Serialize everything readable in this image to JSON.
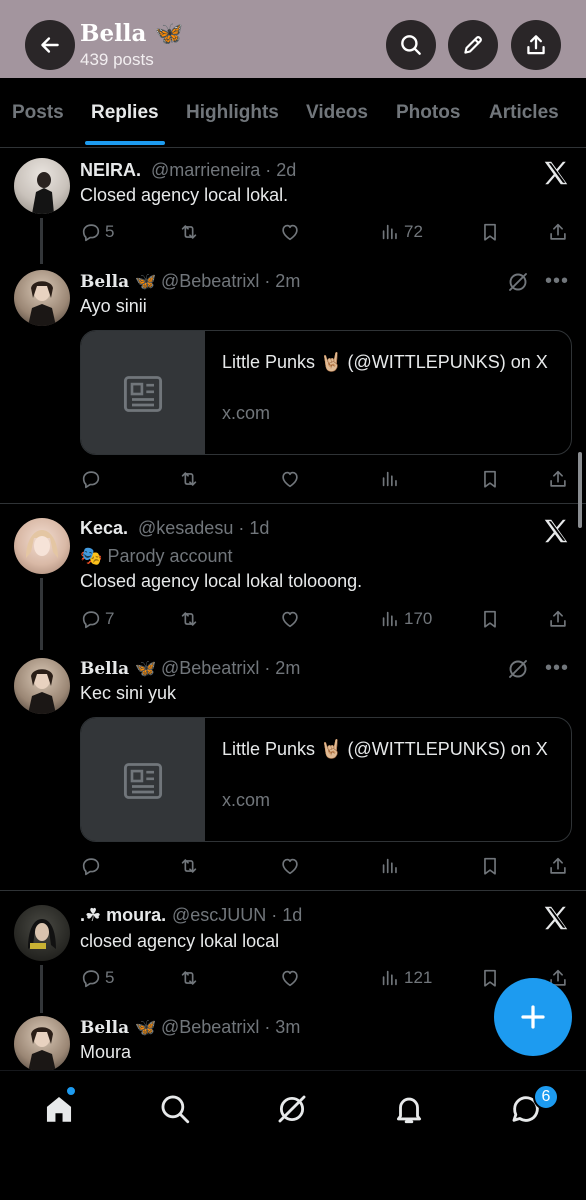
{
  "header": {
    "title": "Bella 🦋",
    "subtitle": "439 posts",
    "bg_color": "#a3959e"
  },
  "tabs": [
    {
      "label": "Posts"
    },
    {
      "label": "Replies"
    },
    {
      "label": "Highlights"
    },
    {
      "label": "Videos"
    },
    {
      "label": "Photos"
    },
    {
      "label": "Articles"
    }
  ],
  "active_tab": "Replies",
  "posts": [
    {
      "name": "NEIRA.",
      "handle": "@marrieneira · 2d",
      "text": "Closed agency local lokal.",
      "replies": "5",
      "reposts": "",
      "likes": "",
      "views": "72"
    },
    {
      "name": "Bella 🦋",
      "handle": "@Bebeatrixl · 2m",
      "text": "Ayo sinii",
      "card_title": "Little Punks 🤘🏼 (@WITTLEPUNKS) on X",
      "card_domain": "x.com"
    },
    {
      "name": "Keca.",
      "handle": "@kesadesu · 1d",
      "parody": "Parody account",
      "parody_emoji": "🎭",
      "text": "Closed agency local lokal tolooong.",
      "replies": "7",
      "views": "170"
    },
    {
      "name": "Bella 🦋",
      "handle": "@Bebeatrixl · 2m",
      "text": "Kec sini yuk",
      "card_title": "Little Punks 🤘🏼 (@WITTLEPUNKS) on X",
      "card_domain": "x.com"
    },
    {
      "name": ".☘︎ moura.",
      "handle": "@escJUUN · 1d",
      "text": "closed agency lokal local",
      "replies": "5",
      "views": "121"
    },
    {
      "name": "Bella 🦋",
      "handle": "@Bebeatrixl · 3m",
      "text": "Moura"
    }
  ],
  "nav": {
    "messages_badge": "6"
  },
  "colors": {
    "accent": "#1d9bf0",
    "muted": "#71767b",
    "text": "#e7e9ea",
    "border": "#2f3336"
  },
  "icons": [
    "back-arrow-icon",
    "search-icon",
    "edit-pencil-icon",
    "share-icon",
    "x-logo-icon",
    "grok-icon",
    "more-icon",
    "reply-icon",
    "repost-icon",
    "like-icon",
    "views-icon",
    "bookmark-icon",
    "article-icon",
    "plus-icon",
    "home-icon",
    "bell-icon",
    "messages-icon"
  ]
}
